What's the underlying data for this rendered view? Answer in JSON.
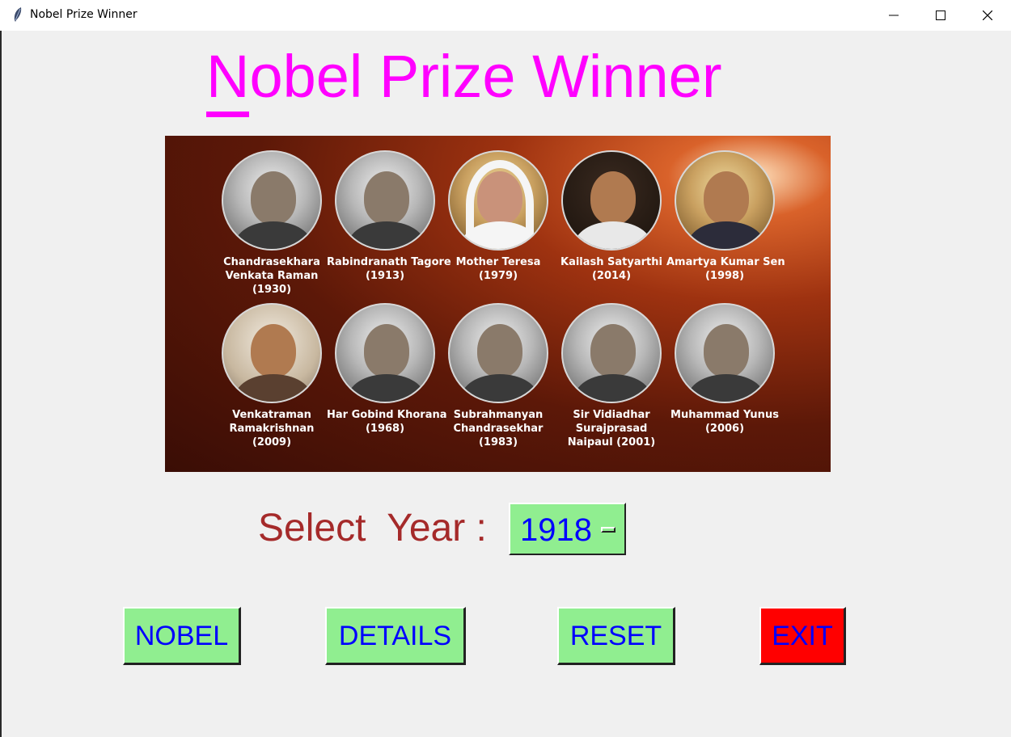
{
  "window": {
    "title": "Nobel Prize Winner",
    "controls": {
      "minimize": "minimize-icon",
      "maximize": "maximize-icon",
      "close": "close-icon"
    }
  },
  "app": {
    "title_first": "N",
    "title_rest": "obel Prize Winner",
    "title_color": "#ff00ff"
  },
  "banner": {
    "laureates": [
      {
        "lines": [
          "Chandrasekhara",
          "Venkata Raman",
          "(1930)"
        ]
      },
      {
        "lines": [
          "Rabindranath Tagore",
          "(1913)"
        ]
      },
      {
        "lines": [
          "Mother Teresa",
          "(1979)"
        ]
      },
      {
        "lines": [
          "Kailash Satyarthi",
          "(2014)"
        ]
      },
      {
        "lines": [
          "Amartya Kumar Sen",
          "(1998)"
        ]
      },
      {
        "lines": [
          "Venkatraman",
          "Ramakrishnan",
          "(2009)"
        ]
      },
      {
        "lines": [
          "Har Gobind Khorana",
          "(1968)"
        ]
      },
      {
        "lines": [
          "Subrahmanyan",
          "Chandrasekhar",
          "(1983)"
        ]
      },
      {
        "lines": [
          "Sir Vidiadhar",
          "Surajprasad",
          "Naipaul (2001)"
        ]
      },
      {
        "lines": [
          "Muhammad Yunus",
          "(2006)"
        ]
      }
    ]
  },
  "year_selector": {
    "label": "Select  Year :",
    "value": "1918",
    "label_color": "#a52a2a"
  },
  "buttons": {
    "nobel": "NOBEL",
    "details": "DETAILS",
    "reset": "RESET",
    "exit": "EXIT"
  },
  "colors": {
    "button_bg": "#90ee90",
    "button_text": "#0000ff",
    "exit_bg": "#ff0000"
  }
}
